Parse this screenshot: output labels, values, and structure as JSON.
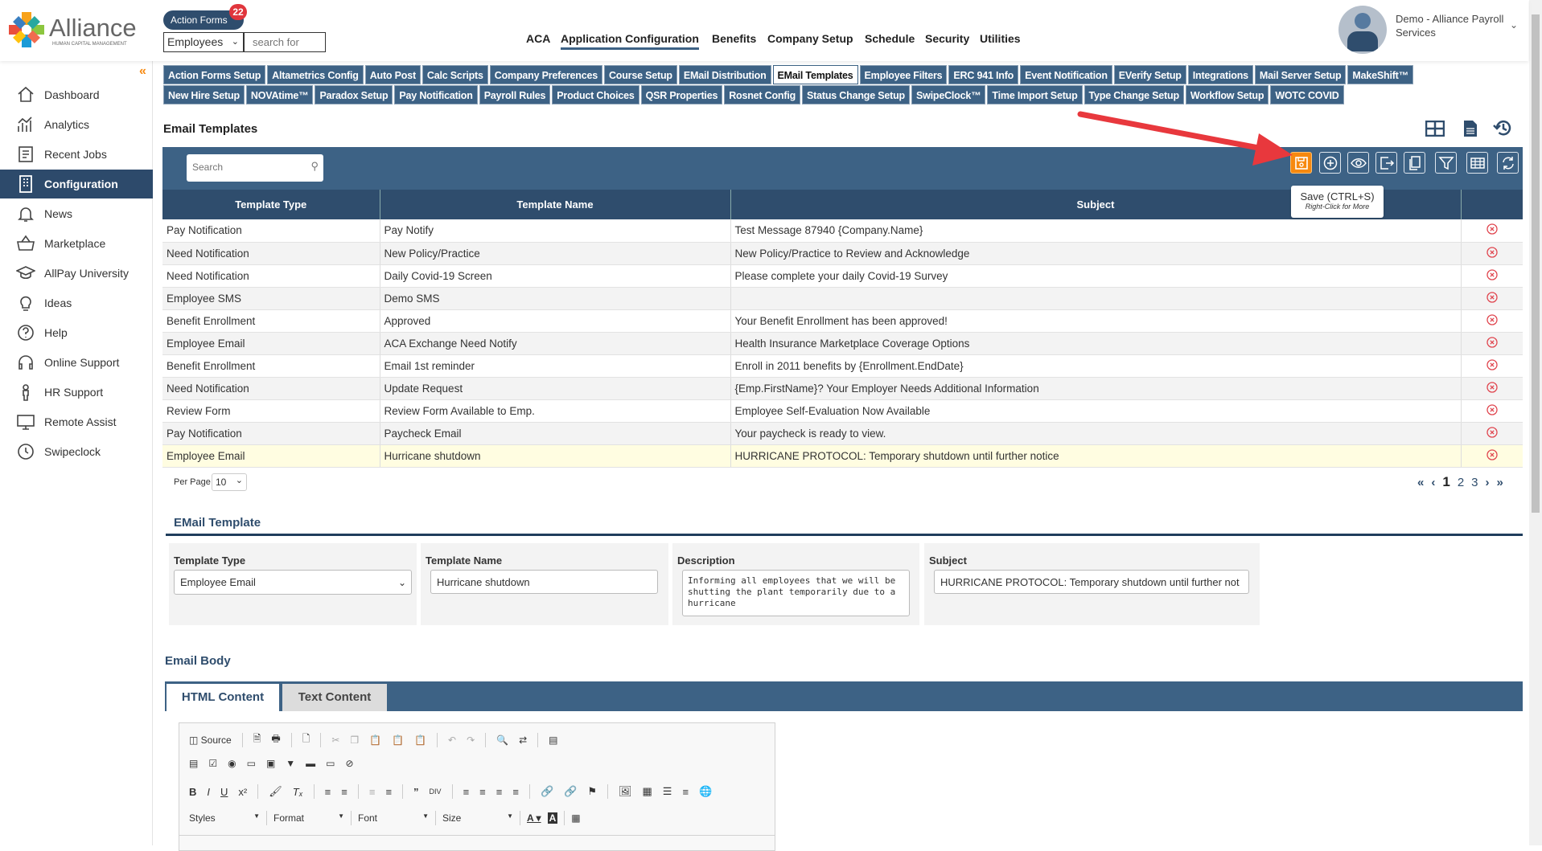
{
  "brand": {
    "name": "Alliance",
    "tagline": "HUMAN CAPITAL MANAGEMENT"
  },
  "header": {
    "action_forms": "Action Forms",
    "action_badge": "22",
    "search_scope": "Employees",
    "search_placeholder": "search for",
    "nav": [
      "ACA",
      "Application Configuration",
      "Benefits",
      "Company Setup",
      "Schedule",
      "Security",
      "Utilities"
    ],
    "active_nav": "Application Configuration",
    "user": "Demo - Alliance Payroll Services"
  },
  "sidebar": {
    "items": [
      {
        "label": "Dashboard",
        "icon": "home-icon"
      },
      {
        "label": "Analytics",
        "icon": "analytics-icon"
      },
      {
        "label": "Recent Jobs",
        "icon": "recent-jobs-icon"
      },
      {
        "label": "Configuration",
        "icon": "building-icon"
      },
      {
        "label": "News",
        "icon": "bell-icon"
      },
      {
        "label": "Marketplace",
        "icon": "basket-icon"
      },
      {
        "label": "AllPay University",
        "icon": "graduation-cap-icon"
      },
      {
        "label": "Ideas",
        "icon": "lightbulb-icon"
      },
      {
        "label": "Help",
        "icon": "help-icon"
      },
      {
        "label": "Online Support",
        "icon": "headset-icon"
      },
      {
        "label": "HR Support",
        "icon": "person-icon"
      },
      {
        "label": "Remote Assist",
        "icon": "monitor-icon"
      },
      {
        "label": "Swipeclock",
        "icon": "clock-icon"
      }
    ],
    "active": "Configuration"
  },
  "config_tabs": {
    "row1": [
      "Action Forms Setup",
      "Altametrics Config",
      "Auto Post",
      "Calc Scripts",
      "Company Preferences",
      "Course Setup",
      "EMail Distribution",
      "EMail Templates",
      "Employee Filters",
      "ERC 941 Info",
      "Event Notification",
      "EVerify Setup",
      "Integrations",
      "Mail Server Setup",
      "MakeShift™"
    ],
    "row2": [
      "New Hire Setup",
      "NOVAtime™",
      "Paradox Setup",
      "Pay Notification",
      "Payroll Rules",
      "Product Choices",
      "QSR Properties",
      "Rosnet Config",
      "Status Change Setup",
      "SwipeClock™",
      "Time Import Setup",
      "Type Change Setup",
      "Workflow Setup",
      "WOTC COVID"
    ],
    "active": "EMail Templates"
  },
  "grid": {
    "title": "Email Templates",
    "search_placeholder": "Search",
    "toolbar": [
      "save",
      "add",
      "view",
      "export",
      "copy",
      "filter",
      "columns",
      "refresh"
    ],
    "tooltip": {
      "title": "Save (CTRL+S)",
      "hint": "Right-Click for More"
    },
    "columns": [
      "Template Type",
      "Template Name",
      "Subject"
    ],
    "rows": [
      [
        "Pay Notification",
        "Pay Notify",
        "Test Message 87940 {Company.Name}"
      ],
      [
        "Need Notification",
        "New Policy/Practice",
        "New Policy/Practice to Review and Acknowledge"
      ],
      [
        "Need Notification",
        "Daily Covid-19 Screen",
        "Please complete your daily Covid-19 Survey"
      ],
      [
        "Employee SMS",
        "Demo SMS",
        ""
      ],
      [
        "Benefit Enrollment",
        "Approved",
        "Your Benefit Enrollment has been approved!"
      ],
      [
        "Employee Email",
        "ACA Exchange Need Notify",
        "Health Insurance Marketplace Coverage Options"
      ],
      [
        "Benefit Enrollment",
        "Email 1st reminder",
        "Enroll in 2011 benefits by {Enrollment.EndDate}"
      ],
      [
        "Need Notification",
        "Update Request",
        "{Emp.FirstName}? Your Employer Needs Additional Information"
      ],
      [
        "Review Form",
        "Review Form Available to Emp.",
        "Employee Self-Evaluation Now Available"
      ],
      [
        "Pay Notification",
        "Paycheck Email",
        "Your paycheck is ready to view."
      ],
      [
        "Employee Email",
        "Hurricane shutdown",
        "HURRICANE PROTOCOL: Temporary shutdown until further notice"
      ]
    ],
    "selected_row": 10,
    "per_page_label": "Per Page",
    "per_page": "10",
    "pages": [
      "1",
      "2",
      "3"
    ],
    "current_page": "1"
  },
  "form": {
    "title": "EMail Template",
    "type_label": "Template Type",
    "type_value": "Employee Email",
    "name_label": "Template Name",
    "name_value": "Hurricane shutdown",
    "desc_label": "Description",
    "desc_value": "Informing all employees that we will be shutting the plant temporarily due to a hurricane",
    "subject_label": "Subject",
    "subject_value": "HURRICANE PROTOCOL: Temporary shutdown until further not"
  },
  "body": {
    "title": "Email Body",
    "tabs": [
      "HTML Content",
      "Text Content"
    ],
    "active_tab": "HTML Content",
    "editor": {
      "source": "Source",
      "styles": "Styles",
      "format": "Format",
      "font": "Font",
      "size": "Size"
    }
  },
  "colors": {
    "primary": "#2f4d6d",
    "accent": "#f7890f",
    "delete": "#e0464f",
    "arrow": "#e8383d"
  }
}
